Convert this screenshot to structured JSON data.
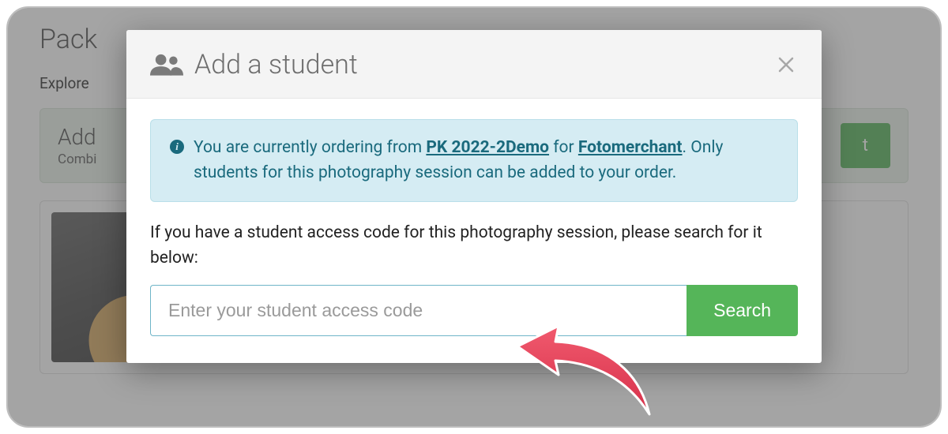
{
  "background": {
    "title": "Pack",
    "subtitle": "Explore",
    "addCard": {
      "heading": "Add",
      "sub": "Combi",
      "button": "t"
    }
  },
  "modal": {
    "title": "Add a student",
    "info": {
      "prefix": "You are currently ordering from ",
      "session": "PK 2022-2Demo",
      "for": " for ",
      "merchant": "Fotomerchant",
      "suffix": ". Only students for this photography session can be added to your order."
    },
    "helpText": "If you have a student access code for this photography session, please search for it below:",
    "search": {
      "placeholder": "Enter your student access code",
      "button": "Search"
    }
  },
  "colors": {
    "accent": "#55b559",
    "infoBg": "#d5ecf3",
    "infoFg": "#1a6a7d",
    "arrow": "#e8465a"
  }
}
